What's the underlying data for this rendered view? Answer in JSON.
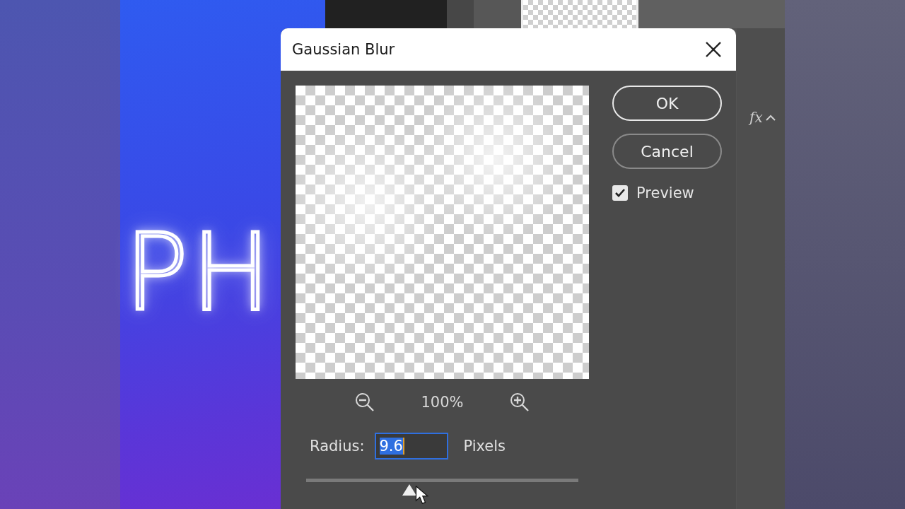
{
  "canvas": {
    "text": "PH"
  },
  "layers_panel": {
    "fx_label": "fx"
  },
  "dialog": {
    "title": "Gaussian Blur",
    "zoom": {
      "percent": "100%"
    },
    "radius": {
      "label": "Radius:",
      "value": "9.6",
      "unit": "Pixels",
      "level": 0.38
    },
    "buttons": [
      {
        "label": "OK",
        "kind": "default"
      },
      {
        "label": "Cancel",
        "kind": "normal"
      }
    ],
    "preview": {
      "label": "Preview",
      "checked": true
    }
  }
}
